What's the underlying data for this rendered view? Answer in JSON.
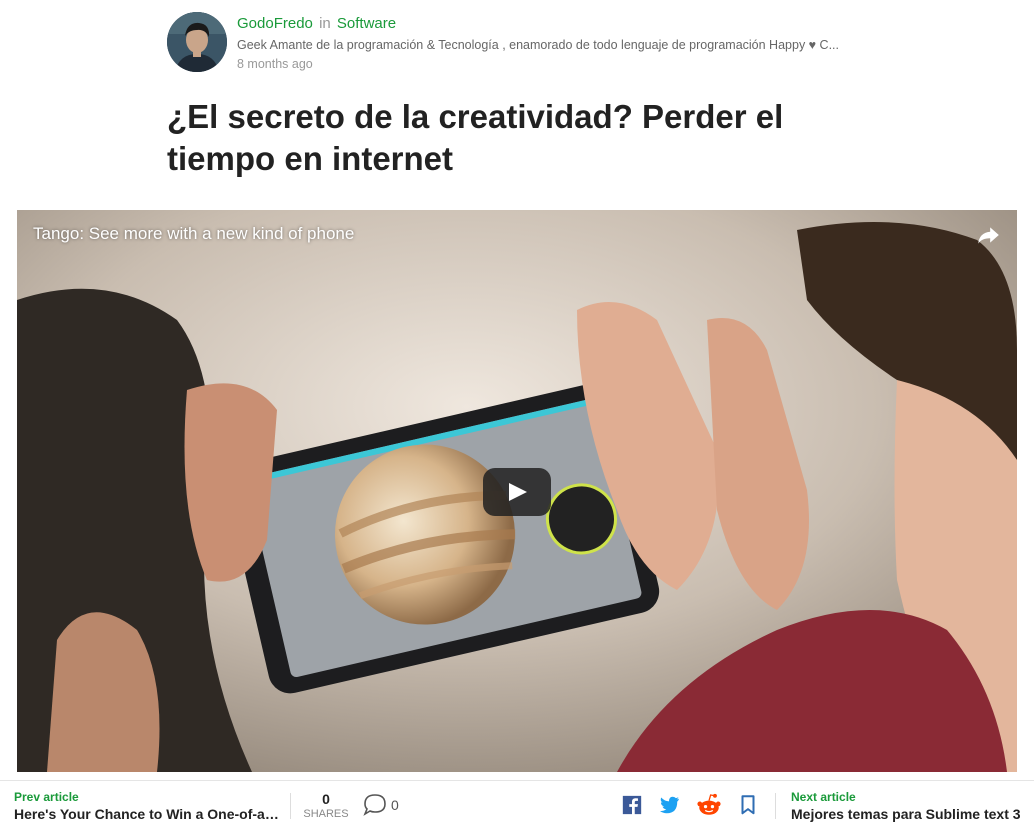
{
  "author": {
    "name": "GodoFredo",
    "in_word": "in",
    "category": "Software",
    "bio": "Geek Amante de la programación & Tecnología , enamorado de todo lenguaje de programación Happy ♥ C...",
    "time": "8 months ago",
    "avatar_icon": "user-avatar"
  },
  "article": {
    "title": "¿El secreto de la creatividad? Perder el tiempo en internet"
  },
  "video": {
    "title": "Tango: See more with a new kind of phone",
    "share_icon": "share-arrow-icon",
    "play_icon": "play-icon"
  },
  "bottom_bar": {
    "prev": {
      "kicker": "Prev article",
      "title": "Here's Your Chance to Win a One-of-a-..."
    },
    "shares": {
      "count": "0",
      "label": "SHARES"
    },
    "comments": {
      "count": "0",
      "icon": "comment-bubble-icon"
    },
    "social_icons": [
      "facebook-icon",
      "twitter-icon",
      "reddit-icon",
      "bookmark-icon"
    ],
    "next": {
      "kicker": "Next article",
      "title": "Mejores temas para Sublime text 3"
    }
  },
  "colors": {
    "accent_green": "#1a9a3a",
    "facebook": "#3b5998",
    "twitter": "#1da1f2",
    "reddit": "#ff4500",
    "bookmark": "#2f6db3"
  }
}
